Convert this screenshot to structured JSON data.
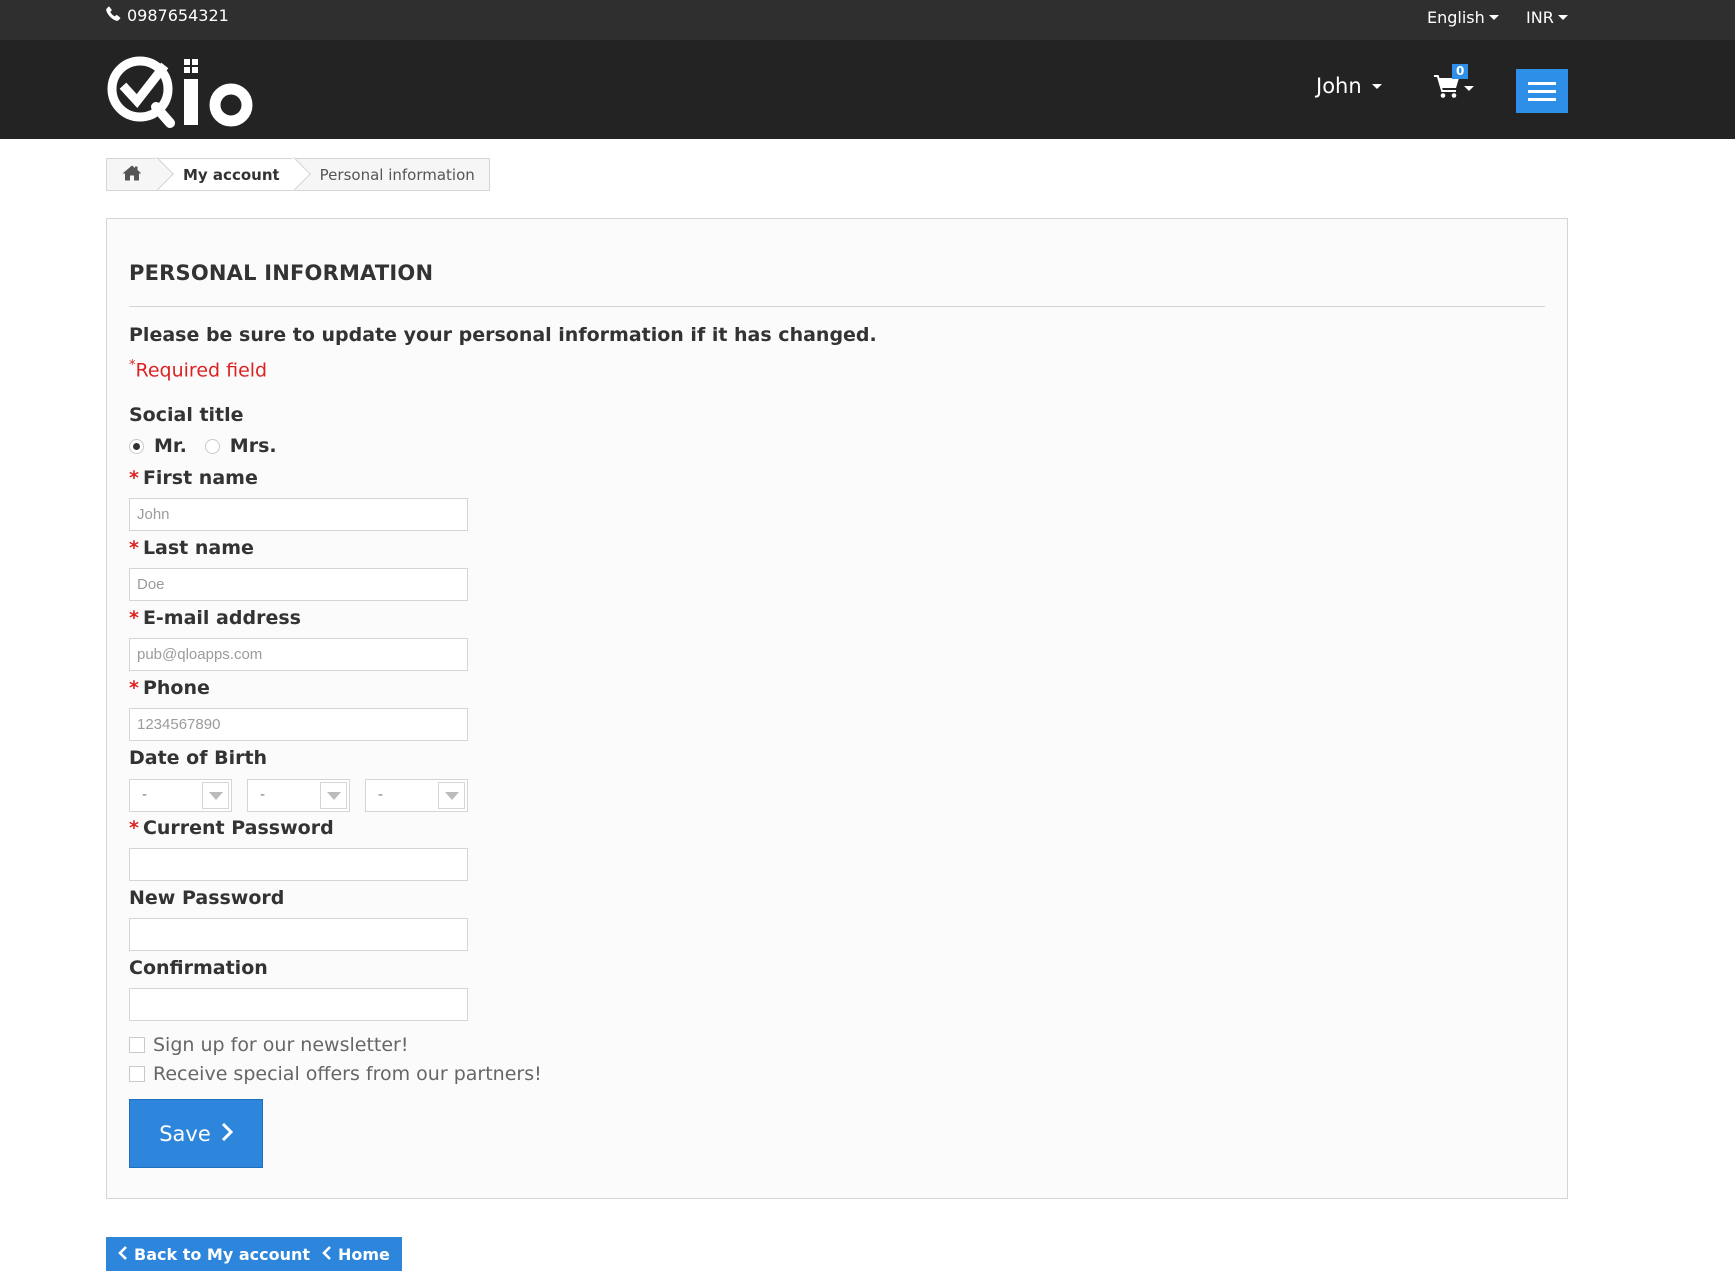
{
  "topbar": {
    "phone": "0987654321",
    "language": "English",
    "currency": "INR",
    "phone_icon": "phone-icon"
  },
  "header": {
    "logo_text": "Qlo",
    "user_name": "John",
    "cart_count": "0",
    "cart_icon": "cart-icon",
    "menu_icon": "hamburger-menu-icon"
  },
  "breadcrumb": {
    "home_icon": "home-icon",
    "items": [
      "My account",
      "Personal information"
    ]
  },
  "form": {
    "heading": "PERSONAL INFORMATION",
    "intro": "Please be sure to update your personal information if it has changed.",
    "required_mark": "*",
    "required_note": "Required field",
    "social_title_label": "Social title",
    "social_title_options": [
      "Mr.",
      "Mrs."
    ],
    "social_title_selected": "Mr.",
    "first_name_label": "First name",
    "first_name_value": "John",
    "last_name_label": "Last name",
    "last_name_value": "Doe",
    "email_label": "E-mail address",
    "email_value": "pub@qloapps.com",
    "phone_label": "Phone",
    "phone_value": "1234567890",
    "dob_label": "Date of Birth",
    "dob_day": "-",
    "dob_month": "-",
    "dob_year": "-",
    "current_password_label": "Current Password",
    "new_password_label": "New Password",
    "confirmation_label": "Confirmation",
    "newsletter_label": "Sign up for our newsletter!",
    "optin_label": "Receive special offers from our partners!",
    "save_label": "Save"
  },
  "footer_nav": {
    "back_label": "Back to My account",
    "home_label": "Home"
  },
  "colors": {
    "accent": "#2e86dc",
    "header_bg": "#232323",
    "topbar_bg": "#2f2f2f",
    "required": "#dd2222"
  }
}
